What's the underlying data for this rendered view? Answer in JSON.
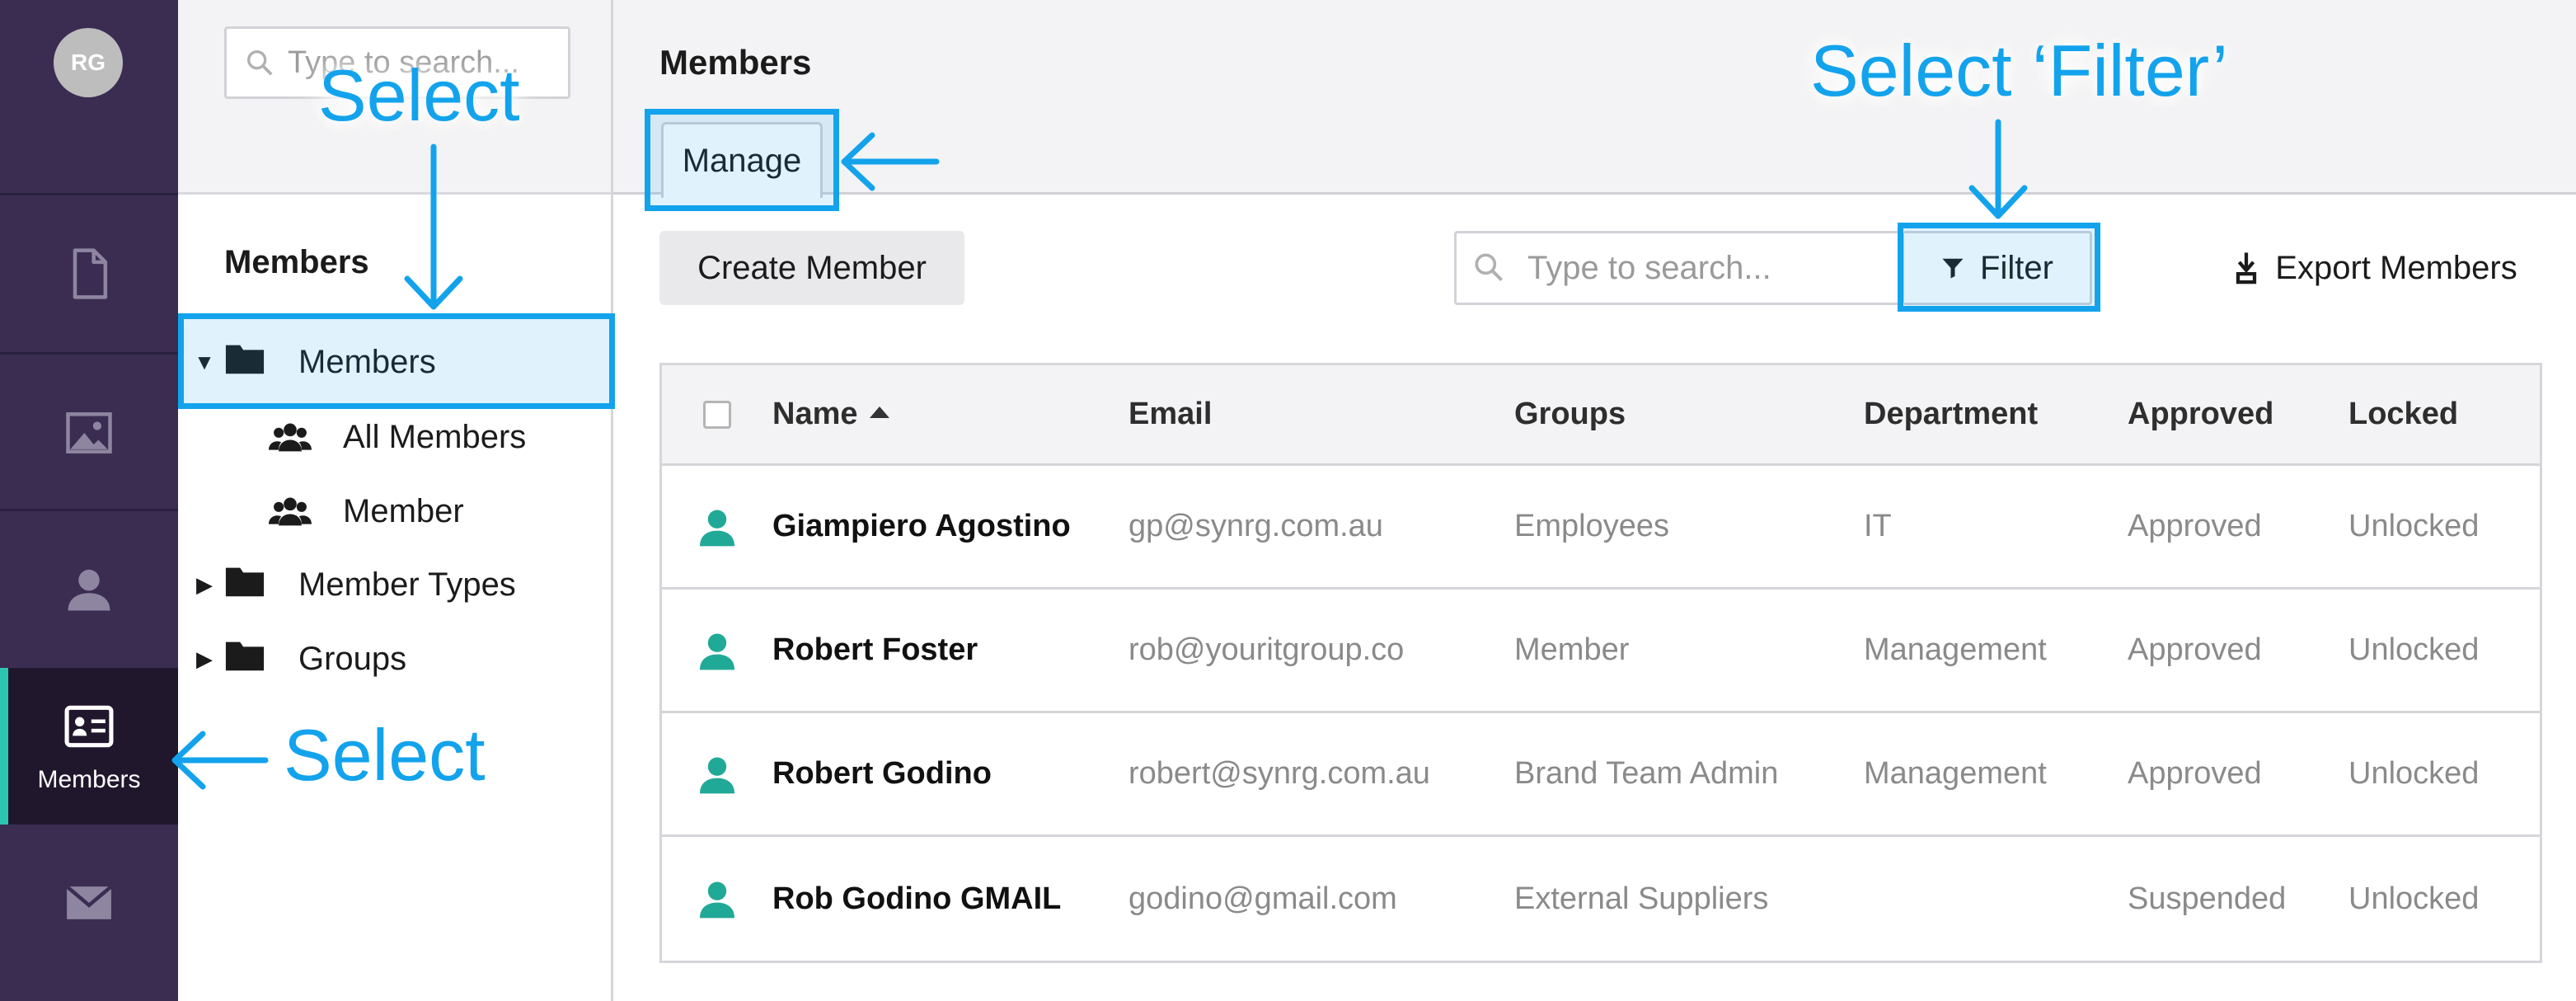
{
  "rail": {
    "avatar_initials": "RG",
    "items": [
      {
        "icon": "document-icon",
        "label": ""
      },
      {
        "icon": "image-icon",
        "label": ""
      },
      {
        "icon": "person-icon",
        "label": ""
      },
      {
        "icon": "member-card-icon",
        "label": "Members",
        "active": true
      },
      {
        "icon": "mail-icon",
        "label": ""
      }
    ],
    "accent_color": "#2dc5b2",
    "background_color": "#3b2d52"
  },
  "tree": {
    "search_placeholder": "Type to search...",
    "heading": "Members",
    "nodes": [
      {
        "label": "Members",
        "expanded": true,
        "icon": "folder-icon"
      },
      {
        "label": "All Members",
        "icon": "people-group-icon"
      },
      {
        "label": "Member",
        "icon": "people-group-icon"
      },
      {
        "label": "Member Types",
        "expanded": false,
        "icon": "folder-icon"
      },
      {
        "label": "Groups",
        "expanded": false,
        "icon": "folder-icon"
      }
    ]
  },
  "main": {
    "title": "Members",
    "tab_label": "Manage",
    "create_button": "Create Member",
    "search_placeholder": "Type to search...",
    "filter_button": "Filter",
    "export_button": "Export Members",
    "table": {
      "columns": [
        "Name",
        "Email",
        "Groups",
        "Department",
        "Approved",
        "Locked"
      ],
      "sorted_by": "Name",
      "rows": [
        {
          "name": "Giampiero Agostino",
          "email": "gp@synrg.com.au",
          "groups": "Employees",
          "department": "IT",
          "approved": "Approved",
          "locked": "Unlocked"
        },
        {
          "name": "Robert Foster",
          "email": "rob@youritgroup.co",
          "groups": "Member",
          "department": "Management",
          "approved": "Approved",
          "locked": "Unlocked"
        },
        {
          "name": "Robert Godino",
          "email": "robert@synrg.com.au",
          "groups": "Brand Team Admin",
          "department": "Management",
          "approved": "Approved",
          "locked": "Unlocked"
        },
        {
          "name": "Rob Godino GMAIL",
          "email": "godino@gmail.com",
          "groups": "External Suppliers",
          "department": "",
          "approved": "Suspended",
          "locked": "Unlocked"
        }
      ]
    }
  },
  "annotations": {
    "select_tree": "Select",
    "select_rail": "Select",
    "select_filter": "Select ‘Filter’",
    "color": "#13a3ec"
  }
}
